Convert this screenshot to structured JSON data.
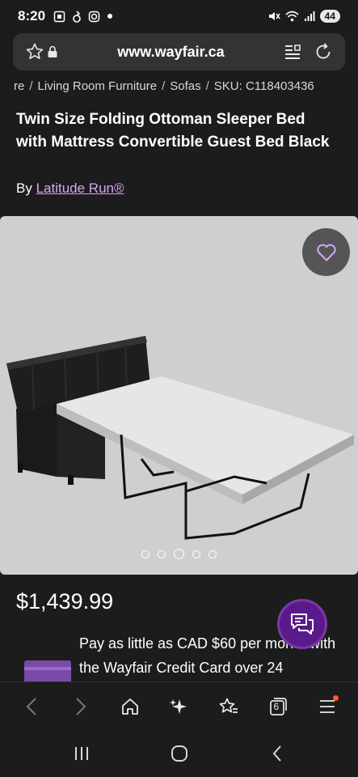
{
  "status_bar": {
    "time": "8:20",
    "battery": "44",
    "left_icons": [
      "screenshot-icon",
      "notification-icon",
      "instagram-icon",
      "dot-icon"
    ],
    "right_icons": [
      "mute-icon",
      "wifi-icon",
      "signal-icon"
    ]
  },
  "browser": {
    "url": "www.wayfair.ca",
    "tab_count": "6"
  },
  "breadcrumb": {
    "items": [
      "re",
      "Living Room Furniture",
      "Sofas",
      "SKU: C118403436"
    ]
  },
  "product": {
    "title": "Twin Size Folding Ottoman Sleeper Bed with Mattress Convertible Guest Bed Black",
    "by_label": "By",
    "brand": "Latitude Run®",
    "image_count": 5,
    "active_image_index": 2,
    "price": "$1,439.99",
    "credit_text": "Pay as little as CAD $60 per month with the Wayfair Credit Card over 24"
  },
  "colors": {
    "background": "#1c1c1c",
    "accent_purple": "#5a1a8a",
    "link": "#d9a6f0",
    "notification": "#ff5a2a"
  }
}
